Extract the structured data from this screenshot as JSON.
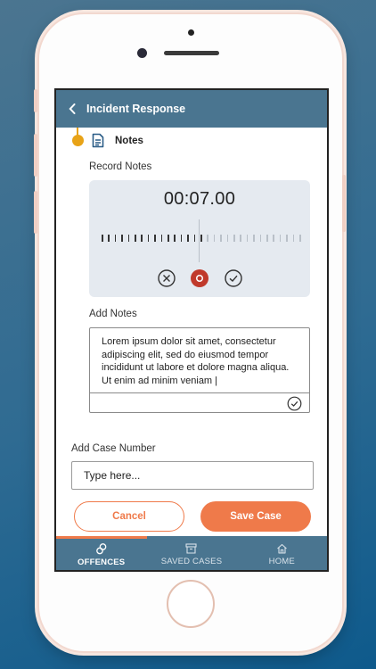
{
  "header": {
    "title": "Incident Response"
  },
  "section": {
    "title": "Notes"
  },
  "recorder": {
    "label": "Record Notes",
    "time": "00:07.00",
    "progress_fraction": 0.5
  },
  "notes": {
    "label": "Add Notes",
    "text": "Lorem ipsum dolor sit amet, consectetur adipiscing elit, sed do eiusmod tempor incididunt ut labore et dolore magna aliqua. Ut enim ad minim veniam |"
  },
  "case": {
    "label": "Add Case Number",
    "placeholder": "Type here..."
  },
  "buttons": {
    "cancel": "Cancel",
    "save": "Save Case"
  },
  "tabs": [
    {
      "label": "OFFENCES",
      "icon": "offences-icon",
      "active": true
    },
    {
      "label": "SAVED CASES",
      "icon": "archive-icon",
      "active": false
    },
    {
      "label": "HOME",
      "icon": "home-icon",
      "active": false
    }
  ],
  "colors": {
    "header": "#4a7590",
    "accent": "#ef7a4a",
    "timeline": "#e8a317",
    "record": "#c0392b"
  }
}
